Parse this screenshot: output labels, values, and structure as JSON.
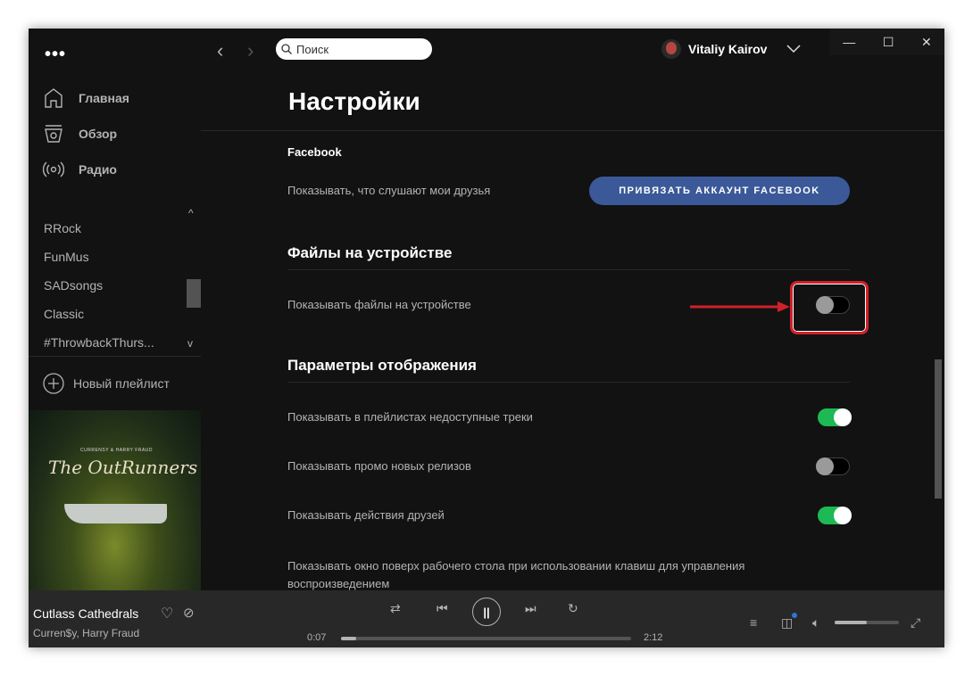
{
  "sidebar": {
    "menu_dots": "•••",
    "nav": [
      {
        "label": "Главная",
        "icon": "home-icon"
      },
      {
        "label": "Обзор",
        "icon": "browse-icon"
      },
      {
        "label": "Радио",
        "icon": "radio-icon"
      }
    ],
    "playlists": [
      "RRock",
      "FunMus",
      "SADsongs",
      "Classic",
      "#ThrowbackThurs..."
    ],
    "new_playlist": "Новый плейлист",
    "cover": {
      "artist_text": "CURRENSY & HARRY FRAUD",
      "title_text": "The OutRunners"
    }
  },
  "topbar": {
    "search_placeholder": "Поиск",
    "user_name": "Vitaliy Kairov"
  },
  "settings": {
    "title": "Настройки",
    "facebook": {
      "heading": "Facebook",
      "label": "Показывать, что слушают мои друзья",
      "button": "ПРИВЯЗАТЬ АККАУНТ FACEBOOK"
    },
    "local_files": {
      "heading": "Файлы на устройстве",
      "label": "Показывать файлы на устройстве",
      "enabled": false
    },
    "display": {
      "heading": "Параметры отображения",
      "items": [
        {
          "label": "Показывать в плейлистах недоступные треки",
          "enabled": true
        },
        {
          "label": "Показывать промо новых релизов",
          "enabled": false
        },
        {
          "label": "Показывать действия друзей",
          "enabled": true
        }
      ],
      "overlay_label": "Показывать окно поверх рабочего стола при использовании клавиш для управления воспроизведением"
    }
  },
  "player": {
    "track": "Cutlass Cathedrals",
    "artist": "Curren$y, Harry Fraud",
    "elapsed": "0:07",
    "duration": "2:12",
    "progress_fraction": 0.053,
    "volume_fraction": 0.5
  },
  "colors": {
    "accent": "#1db954",
    "facebook": "#3b5998",
    "highlight": "#d0202a"
  }
}
